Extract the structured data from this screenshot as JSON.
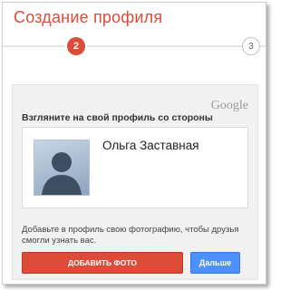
{
  "header": {
    "title": "Создание профиля"
  },
  "steps": {
    "current": "2",
    "next": "3"
  },
  "panel": {
    "brand": "Google",
    "heading": "Взгляните на свой профиль со стороны",
    "profile": {
      "name": "Ольга Заставная",
      "avatar_icon": "person-silhouette-icon"
    },
    "hint": "Добавьте в профиль свою фотографию, чтобы друзья смогли узнать вас.",
    "buttons": {
      "add_photo": "Добавить фото",
      "next": "Дальше"
    }
  },
  "colors": {
    "accent_red": "#dd4b39",
    "button_blue": "#4d90fe"
  }
}
